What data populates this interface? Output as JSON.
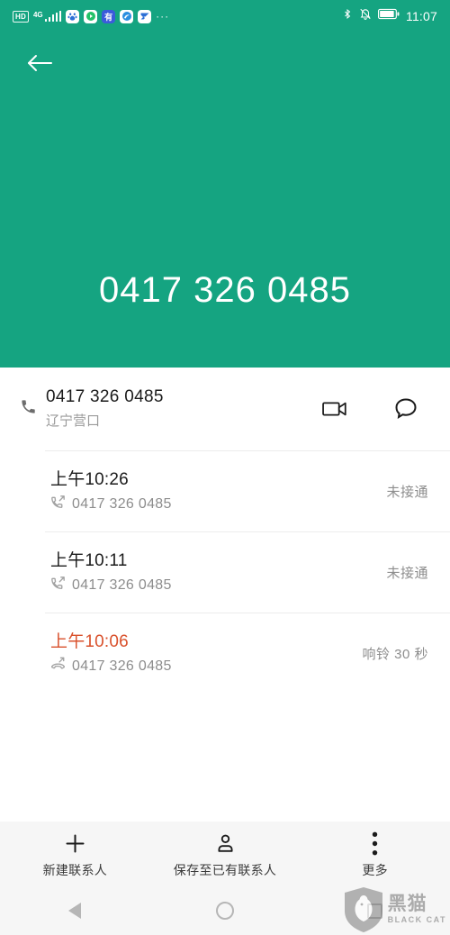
{
  "statusbar": {
    "hd_label": "HD",
    "network_label": "4G",
    "signal_icon": "signal-bars-icon",
    "bluetooth_icon": "bluetooth-icon",
    "mute_icon": "bell-muted-icon",
    "battery_icon": "battery-icon",
    "time": "11:07",
    "more_apps": "···",
    "app_icons": [
      {
        "name": "baidu-app-icon",
        "glyph": "熊",
        "bg": "#ffffff",
        "fg": "#2b6fd6"
      },
      {
        "name": "video-player-app-icon",
        "glyph": "▶",
        "bg": "#ffffff",
        "fg": "#23c268"
      },
      {
        "name": "you-app-icon",
        "glyph": "有",
        "bg": "#3b5bdb",
        "fg": "#ffffff"
      },
      {
        "name": "browser-app-icon",
        "glyph": "◔",
        "bg": "#ffffff",
        "fg": "#2b8fe0"
      },
      {
        "name": "mail-app-icon",
        "glyph": "➤",
        "bg": "#ffffff",
        "fg": "#2b6fd6"
      }
    ]
  },
  "header": {
    "back_icon": "back-arrow-icon",
    "phone_number": "0417 326 0485",
    "background_color": "#15a481"
  },
  "contact": {
    "phone_icon": "phone-handset-icon",
    "number": "0417 326 0485",
    "location": "辽宁营口",
    "video_call_icon": "video-camera-icon",
    "message_icon": "message-bubble-icon"
  },
  "call_log": [
    {
      "time": "上午10:26",
      "type_icon": "outgoing-call-icon",
      "number": "0417 326 0485",
      "status": "未接通",
      "missed": false
    },
    {
      "time": "上午10:11",
      "type_icon": "outgoing-call-icon",
      "number": "0417 326 0485",
      "status": "未接通",
      "missed": false
    },
    {
      "time": "上午10:06",
      "type_icon": "missed-call-icon",
      "number": "0417 326 0485",
      "status": "响铃 30 秒",
      "missed": true
    }
  ],
  "toolbar": {
    "items": [
      {
        "icon": "plus-icon",
        "label": "新建联系人"
      },
      {
        "icon": "person-icon",
        "label": "保存至已有联系人"
      },
      {
        "icon": "more-vertical-icon",
        "label": "更多"
      }
    ]
  },
  "navbar": {
    "back_icon": "nav-back-triangle-icon",
    "home_icon": "nav-home-circle-icon",
    "recents_icon": "nav-recents-square-icon"
  },
  "watermark": {
    "shield_icon": "black-cat-shield-icon",
    "cn_text": "黑猫",
    "en_text": "BLACK CAT"
  },
  "colors": {
    "accent_green": "#15a481",
    "missed_orange": "#d9512c",
    "toolbar_bg": "#f6f6f6",
    "secondary_text": "#8d8d8d"
  }
}
